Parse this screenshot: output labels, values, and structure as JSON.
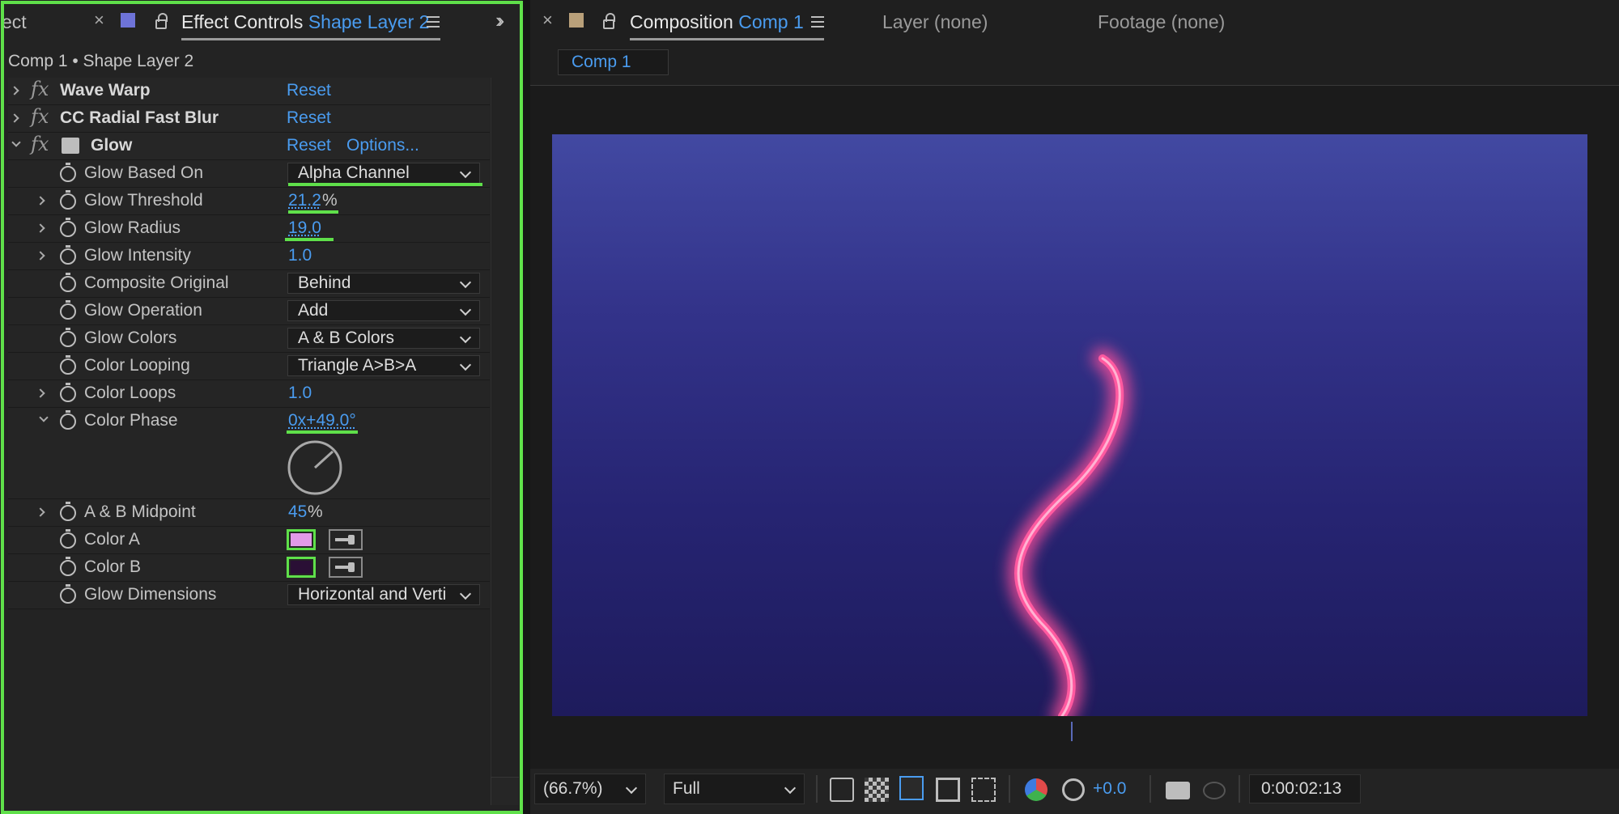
{
  "left_panel": {
    "tabs": {
      "prev_tab_partial": "ect",
      "active_tab_title": "Effect Controls",
      "active_tab_layer": "Shape Layer 2"
    },
    "breadcrumb": "Comp 1 • Shape Layer 2",
    "effects": [
      {
        "name": "Wave Warp",
        "reset": "Reset"
      },
      {
        "name": "CC Radial Fast Blur",
        "reset": "Reset"
      },
      {
        "name": "Glow",
        "reset": "Reset",
        "options": "Options..."
      }
    ],
    "glow_params": {
      "glow_based_on": {
        "label": "Glow Based On",
        "value": "Alpha Channel"
      },
      "glow_threshold": {
        "label": "Glow Threshold",
        "value": "21.2",
        "unit": "%"
      },
      "glow_radius": {
        "label": "Glow Radius",
        "value": "19.0"
      },
      "glow_intensity": {
        "label": "Glow Intensity",
        "value": "1.0"
      },
      "composite_original": {
        "label": "Composite Original",
        "value": "Behind"
      },
      "glow_operation": {
        "label": "Glow Operation",
        "value": "Add"
      },
      "glow_colors": {
        "label": "Glow Colors",
        "value": "A & B Colors"
      },
      "color_looping": {
        "label": "Color Looping",
        "value": "Triangle A>B>A"
      },
      "color_loops": {
        "label": "Color Loops",
        "value": "1.0"
      },
      "color_phase": {
        "label": "Color Phase",
        "value": "0x+49.0°"
      },
      "ab_midpoint": {
        "label": "A & B Midpoint",
        "value": "45",
        "unit": "%"
      },
      "color_a": {
        "label": "Color A",
        "color": "#e29ae8"
      },
      "color_b": {
        "label": "Color B",
        "color": "#2a0f35"
      },
      "glow_dimensions": {
        "label": "Glow Dimensions",
        "value": "Horizontal and Verti"
      }
    }
  },
  "right_panel": {
    "tabs": {
      "composition_title": "Composition",
      "composition_name": "Comp 1",
      "layer_tab": "Layer (none)",
      "footage_tab": "Footage (none)"
    },
    "comp_button": "Comp 1",
    "bottom_bar": {
      "zoom": "(66.7%)",
      "resolution": "Full",
      "exposure": "+0.0",
      "timecode": "0:00:02:13"
    }
  },
  "colors": {
    "accent_blue": "#4a9cf0",
    "highlight_green": "#5fe04a",
    "glow_pink": "#ff5aa0"
  }
}
